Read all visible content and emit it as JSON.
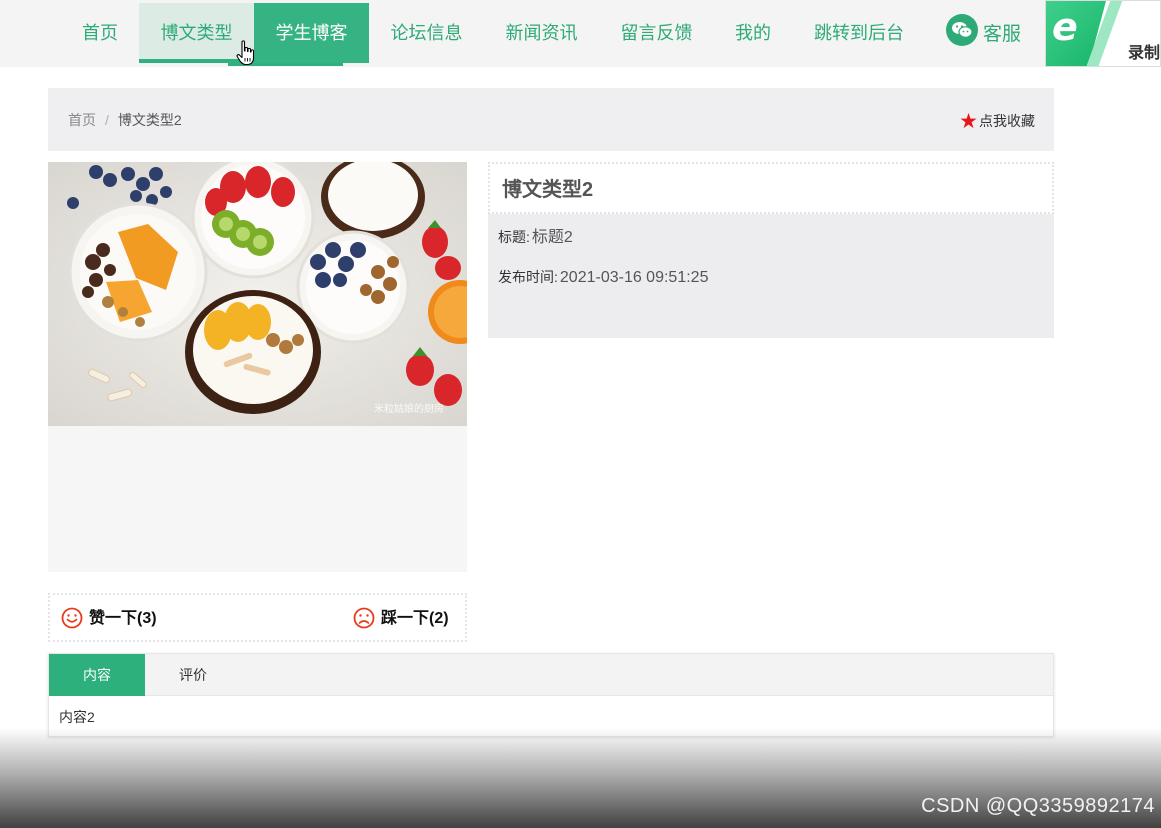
{
  "nav": {
    "items": [
      {
        "label": "首页",
        "state": "normal"
      },
      {
        "label": "博文类型",
        "state": "hover"
      },
      {
        "label": "学生博客",
        "state": "active"
      },
      {
        "label": "论坛信息",
        "state": "normal"
      },
      {
        "label": "新闻资讯",
        "state": "normal"
      },
      {
        "label": "留言反馈",
        "state": "normal"
      },
      {
        "label": "我的",
        "state": "normal"
      },
      {
        "label": "跳转到后台",
        "state": "normal"
      }
    ],
    "service_label": "客服",
    "record_label": "录制",
    "accent_color": "#2eaa78"
  },
  "breadcrumb": {
    "home": "首页",
    "separator": "/",
    "current": "博文类型2"
  },
  "favorite": {
    "label": "点我收藏",
    "icon": "star-icon",
    "icon_color": "#e8161b"
  },
  "photo": {
    "subject": "fruit and yogurt bowls",
    "watermark": "米粒姑娘的厨房"
  },
  "detail": {
    "title": "博文类型2",
    "fields": [
      {
        "label": "标题:",
        "value": "标题2"
      },
      {
        "label": "发布时间:",
        "value": "2021-03-16 09:51:25"
      }
    ]
  },
  "votes": {
    "like_label": "赞一下(3)",
    "dislike_label": "踩一下(2)",
    "icon_color": "#e8391d"
  },
  "tabs": {
    "items": [
      {
        "label": "内容",
        "active": true
      },
      {
        "label": "评价",
        "active": false
      }
    ],
    "content": "内容2"
  },
  "watermark": "CSDN @QQ3359892174"
}
